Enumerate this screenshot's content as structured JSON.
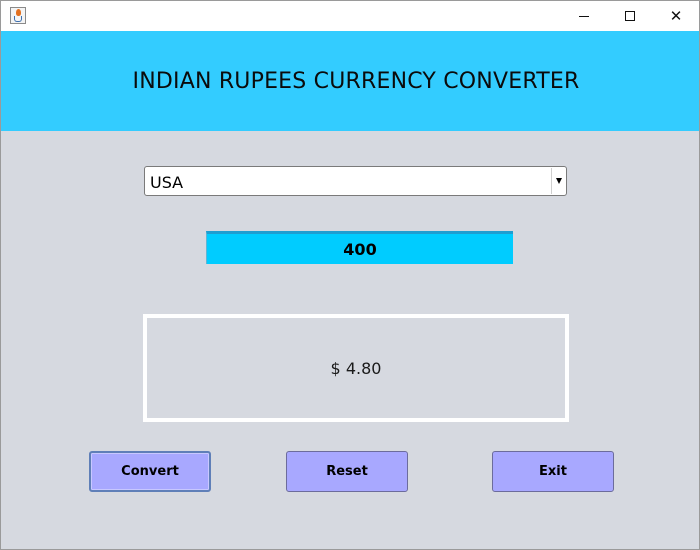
{
  "window": {
    "title": "",
    "controls": {
      "minimize_icon": "minimize-icon",
      "maximize_icon": "maximize-icon",
      "close_icon": "close-icon",
      "close_glyph": "✕"
    }
  },
  "header": {
    "title": "INDIAN RUPEES CURRENCY CONVERTER",
    "background": "#33ccff"
  },
  "country_select": {
    "selected": "USA"
  },
  "amount_field": {
    "value": "400",
    "background": "#00ccff"
  },
  "result": {
    "text": "$ 4.80"
  },
  "buttons": {
    "convert": "Convert",
    "reset": "Reset",
    "exit": "Exit",
    "color": "#a8a8ff"
  }
}
